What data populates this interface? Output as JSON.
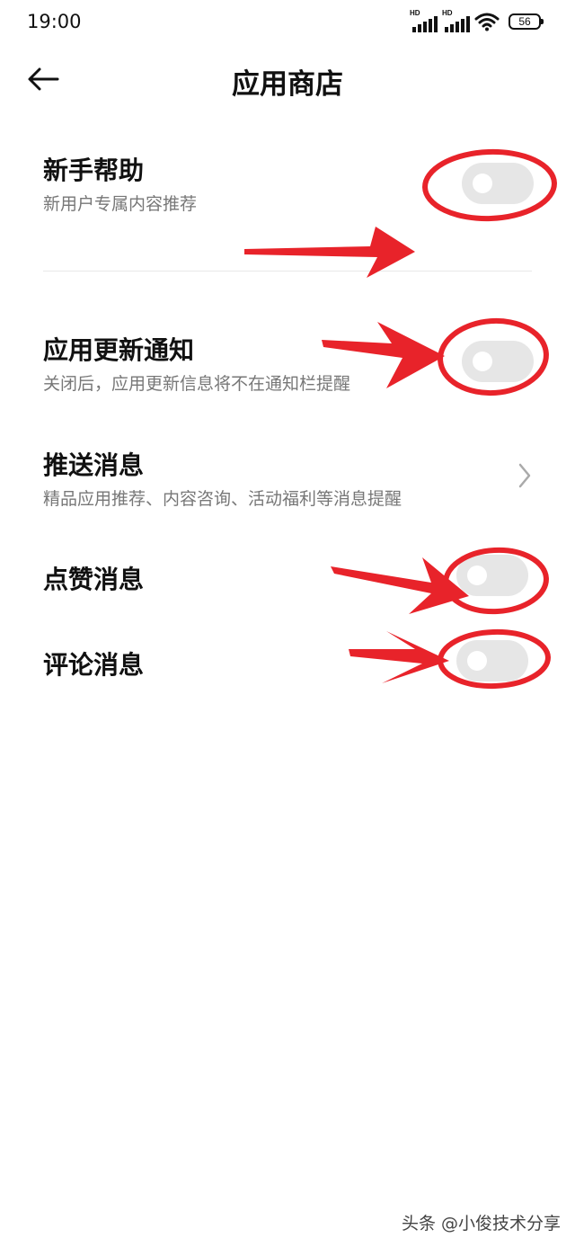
{
  "status_bar": {
    "time": "19:00",
    "sim1_label": "HD",
    "sim2_label": "HD",
    "battery": "56"
  },
  "header": {
    "title": "应用商店",
    "back_icon": "arrow-left-icon"
  },
  "settings": {
    "beginner_help": {
      "title": "新手帮助",
      "subtitle": "新用户专属内容推荐",
      "toggle_on": false
    },
    "update_notify": {
      "title": "应用更新通知",
      "subtitle": "关闭后，应用更新信息将不在通知栏提醒",
      "toggle_on": false
    },
    "push_messages": {
      "title": "推送消息",
      "subtitle": "精品应用推荐、内容咨询、活动福利等消息提醒",
      "chevron_icon": "chevron-right-icon"
    },
    "like_messages": {
      "title": "点赞消息",
      "toggle_on": false
    },
    "comment_messages": {
      "title": "评论消息",
      "toggle_on": false
    }
  },
  "watermark": "头条 @小俊技术分享",
  "colors": {
    "annotation_red": "#e8232a",
    "toggle_off": "#e6e6e6",
    "subtitle_gray": "#777777"
  }
}
